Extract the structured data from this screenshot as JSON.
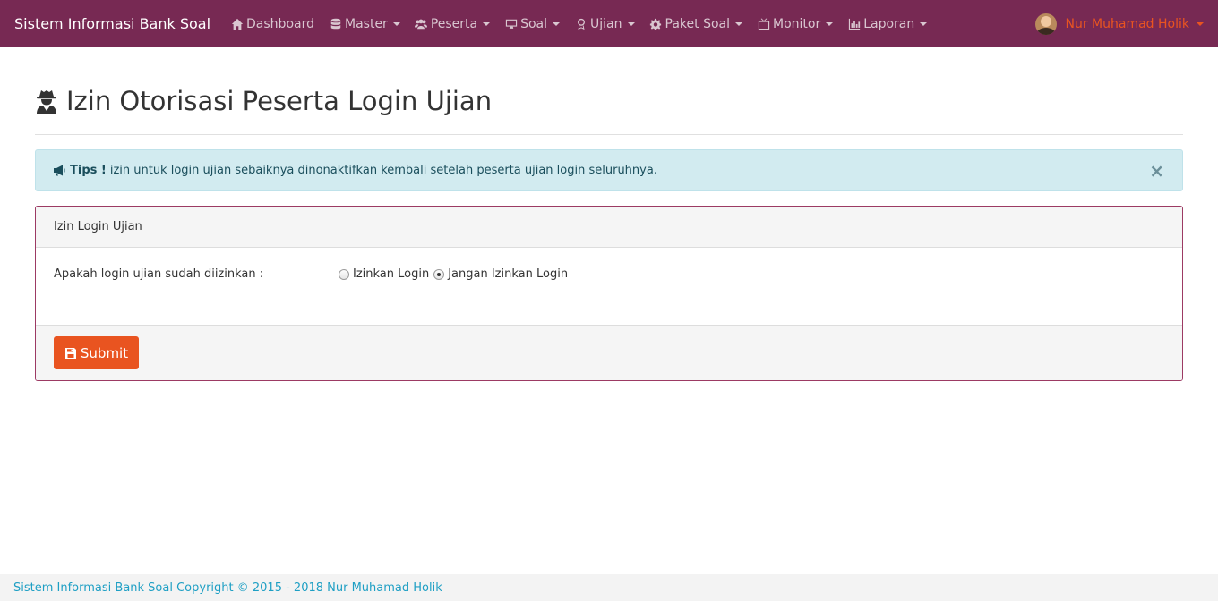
{
  "navbar": {
    "brand": "Sistem Informasi Bank Soal",
    "items": [
      {
        "label": "Dashboard",
        "icon": "home-icon",
        "dropdown": false
      },
      {
        "label": "Master",
        "icon": "database-icon",
        "dropdown": true
      },
      {
        "label": "Peserta",
        "icon": "users-icon",
        "dropdown": true
      },
      {
        "label": "Soal",
        "icon": "desktop-icon",
        "dropdown": true
      },
      {
        "label": "Ujian",
        "icon": "award-icon",
        "dropdown": true
      },
      {
        "label": "Paket Soal",
        "icon": "gear-icon",
        "dropdown": true
      },
      {
        "label": "Monitor",
        "icon": "tv-icon",
        "dropdown": true
      },
      {
        "label": "Laporan",
        "icon": "bar-chart-icon",
        "dropdown": true
      }
    ],
    "user": "Nur Muhamad Holik"
  },
  "page": {
    "title": "Izin Otorisasi Peserta Login Ujian",
    "title_icon": "user-secret-icon"
  },
  "alert": {
    "icon": "bullhorn-icon",
    "strong": "Tips !",
    "text": "izin untuk login ujian sebaiknya dinonaktifkan kembali setelah peserta ujian login seluruhnya.",
    "close": "×"
  },
  "panel": {
    "heading": "Izin Login Ujian",
    "question": "Apakah login ujian sudah diizinkan :",
    "options": [
      {
        "label": "Izinkan Login",
        "checked": false
      },
      {
        "label": "Jangan Izinkan Login",
        "checked": true
      }
    ],
    "submit": "Submit"
  },
  "footer": {
    "text": "Sistem Informasi Bank Soal Copyright © 2015 - 2018 Nur Muhamad Holik"
  },
  "colors": {
    "navbar": "#772953",
    "accent": "#e95420",
    "alert_bg": "#d2ebf0",
    "footer_text": "#1e9fc4"
  }
}
